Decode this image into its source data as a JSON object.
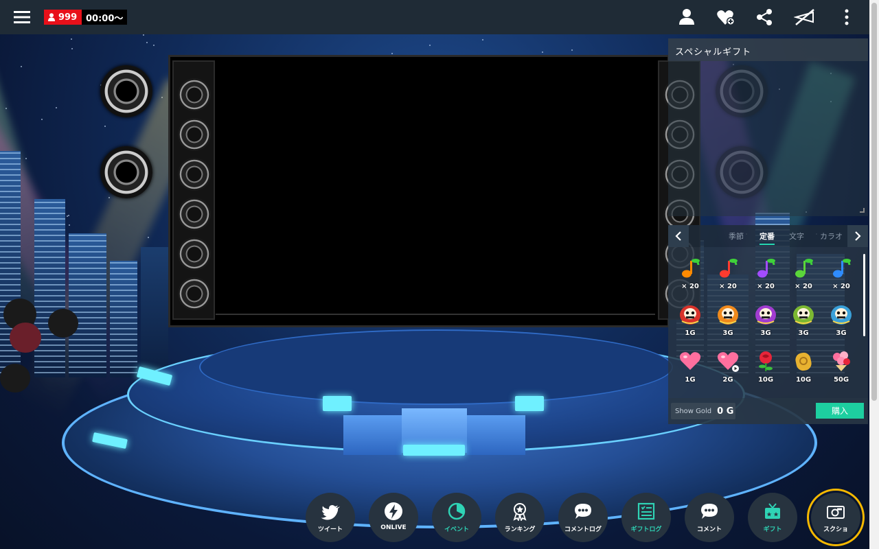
{
  "topbar": {
    "viewer_count": "999",
    "time": "00:00〜",
    "icons": [
      "menu-icon",
      "person-icon",
      "heart-plus-icon",
      "share-icon",
      "mute-icon",
      "more-vertical-icon"
    ]
  },
  "gift_panel": {
    "title": "スペシャルギフト",
    "tabs": [
      {
        "label": "季節",
        "active": false
      },
      {
        "label": "定番",
        "active": true
      },
      {
        "label": "文字",
        "active": false
      },
      {
        "label": "カラオ",
        "active": false
      }
    ],
    "gifts": [
      {
        "name": "note-orange",
        "price": "× 20",
        "color": "#ff8a00"
      },
      {
        "name": "note-red",
        "price": "× 20",
        "color": "#ff3b2f"
      },
      {
        "name": "note-purple",
        "price": "× 20",
        "color": "#a24cff"
      },
      {
        "name": "note-green",
        "price": "× 20",
        "color": "#5bd53a"
      },
      {
        "name": "note-blue",
        "price": "× 20",
        "color": "#2f8cff"
      },
      {
        "name": "daruma-red",
        "price": "1G",
        "color": "#d8332a"
      },
      {
        "name": "daruma-orange",
        "price": "3G",
        "color": "#f08a1c"
      },
      {
        "name": "daruma-purple",
        "price": "3G",
        "color": "#a23cd0"
      },
      {
        "name": "daruma-green",
        "price": "3G",
        "color": "#7cb832"
      },
      {
        "name": "daruma-blue",
        "price": "3G",
        "color": "#3aa0d8"
      },
      {
        "name": "heart-pink",
        "price": "1G",
        "color": "#ff6f9e"
      },
      {
        "name": "heart-pink-play",
        "price": "2G",
        "color": "#ff6f9e"
      },
      {
        "name": "rose",
        "price": "10G",
        "color": "#e8253a"
      },
      {
        "name": "gold-charm",
        "price": "10G",
        "color": "#e8b230"
      },
      {
        "name": "bouquet",
        "price": "50G",
        "color": "#ff8fb3"
      }
    ],
    "gold_label": "Show Gold",
    "gold_value": "0 G",
    "buy_label": "購入"
  },
  "bottom_bar": [
    {
      "name": "tweet-button",
      "label": "ツイート",
      "icon": "twitter-icon",
      "teal": false
    },
    {
      "name": "onlive-button",
      "label": "ONLIVE",
      "icon": "lightning-icon",
      "teal": false
    },
    {
      "name": "event-button",
      "label": "イベント",
      "icon": "pie-clock-icon",
      "teal": true
    },
    {
      "name": "ranking-button",
      "label": "ランキング",
      "icon": "medal-icon",
      "teal": false
    },
    {
      "name": "comment-log-button",
      "label": "コメントログ",
      "icon": "chat-bubble-icon",
      "teal": false
    },
    {
      "name": "gift-log-button",
      "label": "ギフトログ",
      "icon": "list-card-icon",
      "teal": true
    },
    {
      "name": "comment-button",
      "label": "コメント",
      "icon": "chat-bubble-icon",
      "teal": false
    },
    {
      "name": "gift-button",
      "label": "ギフト",
      "icon": "gift-tv-icon",
      "teal": true
    },
    {
      "name": "screenshot-button",
      "label": "スクショ",
      "icon": "camera-icon",
      "teal": false
    }
  ]
}
